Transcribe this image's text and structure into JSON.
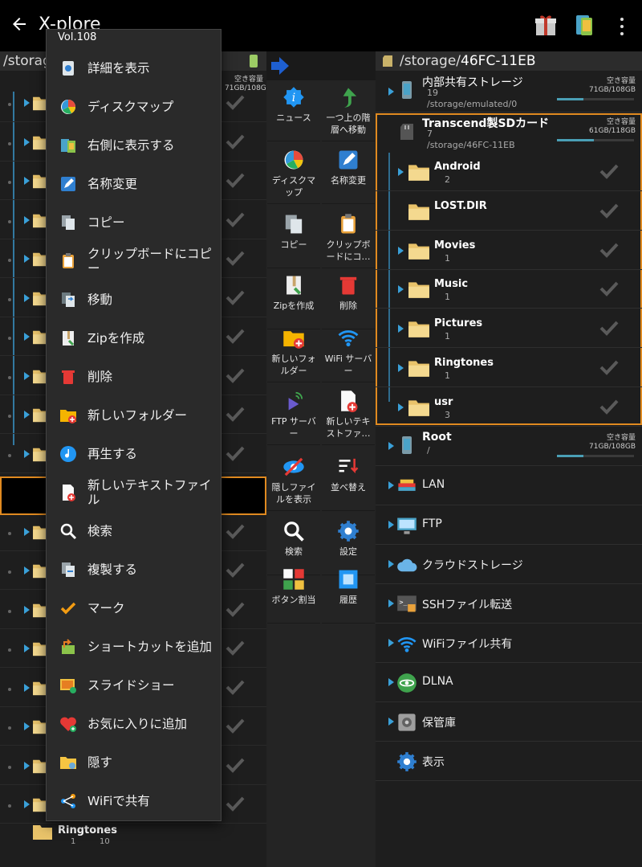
{
  "app": {
    "title": "X-plore",
    "more_menu_label": "⋮"
  },
  "left_pane": {
    "path": "/storage/emulated/0/Vo…",
    "bottom_item": {
      "name": "Ringtones",
      "dirs": "1",
      "files": "10"
    },
    "free_label": "空き容量",
    "free_value": "71GB/108GB"
  },
  "menu": {
    "header": "Vol.108",
    "items": [
      {
        "label": "詳細を表示",
        "icon": "info-icon"
      },
      {
        "label": "ディスクマップ",
        "icon": "disk-map-icon"
      },
      {
        "label": "右側に表示する",
        "icon": "show-right-icon"
      },
      {
        "label": "名称変更",
        "icon": "rename-icon"
      },
      {
        "label": "コピー",
        "icon": "copy-icon"
      },
      {
        "label": "クリップボードにコピー",
        "icon": "clipboard-icon"
      },
      {
        "label": "移動",
        "icon": "move-icon"
      },
      {
        "label": "Zipを作成",
        "icon": "zip-icon"
      },
      {
        "label": "削除",
        "icon": "delete-icon"
      },
      {
        "label": "新しいフォルダー",
        "icon": "new-folder-icon"
      },
      {
        "label": "再生する",
        "icon": "play-icon"
      },
      {
        "label": "新しいテキストファイル",
        "icon": "new-text-file-icon"
      },
      {
        "label": "検索",
        "icon": "search-icon"
      },
      {
        "label": "複製する",
        "icon": "duplicate-icon"
      },
      {
        "label": "マーク",
        "icon": "check-icon"
      },
      {
        "label": "ショートカットを追加",
        "icon": "shortcut-icon"
      },
      {
        "label": "スライドショー",
        "icon": "slideshow-icon"
      },
      {
        "label": "お気に入りに追加",
        "icon": "favorite-icon"
      },
      {
        "label": "隠す",
        "icon": "hide-icon"
      },
      {
        "label": "WiFiで共有",
        "icon": "share-icon"
      }
    ]
  },
  "toolbar": {
    "items": [
      {
        "label": "ニュース",
        "icon": "news-icon"
      },
      {
        "label": "一つ上の階層へ移動",
        "icon": "up-level-icon"
      },
      {
        "label": "ディスクマップ",
        "icon": "disk-map-icon"
      },
      {
        "label": "名称変更",
        "icon": "rename-icon"
      },
      {
        "label": "コピー",
        "icon": "copy-icon"
      },
      {
        "label": "クリップボードにコ…",
        "icon": "clipboard-icon"
      },
      {
        "label": "Zipを作成",
        "icon": "zip-icon"
      },
      {
        "label": "削除",
        "icon": "delete-icon"
      },
      {
        "label": "新しいフォルダー",
        "icon": "new-folder-icon"
      },
      {
        "label": "WiFi サーバー",
        "icon": "wifi-server-icon"
      },
      {
        "label": "FTP サーバー",
        "icon": "ftp-server-icon"
      },
      {
        "label": "新しいテキストファ…",
        "icon": "new-text-file-icon"
      },
      {
        "label": "隠しファイルを表示",
        "icon": "hidden-files-icon"
      },
      {
        "label": "並べ替え",
        "icon": "sort-icon"
      },
      {
        "label": "検索",
        "icon": "search-icon"
      },
      {
        "label": "設定",
        "icon": "settings-icon"
      },
      {
        "label": "ボタン割当",
        "icon": "button-assign-icon"
      },
      {
        "label": "履歴",
        "icon": "history-icon"
      }
    ]
  },
  "right_pane": {
    "path_prefix": "/storage/",
    "path_current": "46FC-11EB",
    "internal": {
      "name": "内部共有ストレージ",
      "count": "19",
      "path": "/storage/emulated/0",
      "free_label": "空き容量",
      "free_value": "71GB/108GB",
      "fill": 0.34
    },
    "sdcard": {
      "name": "Transcend製SDカード",
      "count": "7",
      "path": "/storage/46FC-11EB",
      "free_label": "空き容量",
      "free_value": "61GB/118GB",
      "fill": 0.48
    },
    "folders": [
      {
        "name": "Android",
        "count": "2"
      },
      {
        "name": "LOST.DIR",
        "count": ""
      },
      {
        "name": "Movies",
        "count": "1"
      },
      {
        "name": "Music",
        "count": "1"
      },
      {
        "name": "Pictures",
        "count": "1"
      },
      {
        "name": "Ringtones",
        "count": "1"
      },
      {
        "name": "usr",
        "count": "3"
      }
    ],
    "root": {
      "name": "Root",
      "path": "/",
      "free_label": "空き容量",
      "free_value": "71GB/108GB",
      "fill": 0.34
    },
    "network": [
      {
        "name": "LAN",
        "icon": "lan-icon"
      },
      {
        "name": "FTP",
        "icon": "ftp-icon"
      },
      {
        "name": "クラウドストレージ",
        "icon": "cloud-icon"
      },
      {
        "name": "SSHファイル転送",
        "icon": "ssh-icon"
      },
      {
        "name": "WiFiファイル共有",
        "icon": "wifi-icon"
      },
      {
        "name": "DLNA",
        "icon": "dlna-icon"
      },
      {
        "name": "保管庫",
        "icon": "vault-icon"
      },
      {
        "name": "表示",
        "icon": "settings-icon"
      }
    ]
  },
  "colors": {
    "accent_orange": "#e08a20",
    "link_blue": "#3aa0d8",
    "folder": "#e9c36a"
  }
}
